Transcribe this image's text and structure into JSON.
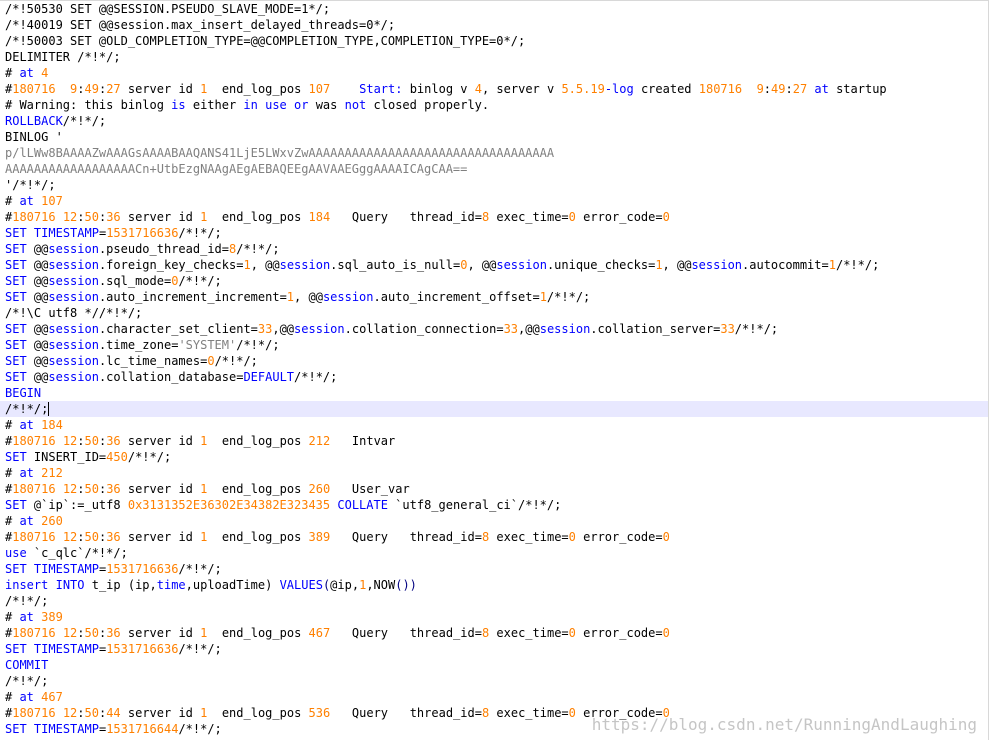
{
  "editor": {
    "current_line": 25,
    "lines": [
      [
        [
          "d",
          "/*!50530 SET @@SESSION.PSEUDO_SLAVE_MODE=1*/;"
        ]
      ],
      [
        [
          "d",
          "/*!40019 SET @@session.max_insert_delayed_threads=0*/;"
        ]
      ],
      [
        [
          "d",
          "/*!50003 SET @OLD_COMPLETION_TYPE=@@COMPLETION_TYPE,COMPLETION_TYPE=0*/;"
        ]
      ],
      [
        [
          "d",
          "DELIMITER /*!*/;"
        ]
      ],
      [
        [
          "d",
          "# "
        ],
        [
          "k",
          "at"
        ],
        [
          "d",
          " "
        ],
        [
          "n",
          "4"
        ]
      ],
      [
        [
          "d",
          "#"
        ],
        [
          "n",
          "180716"
        ],
        [
          "d",
          "  "
        ],
        [
          "n",
          "9"
        ],
        [
          "d",
          ":"
        ],
        [
          "n",
          "49"
        ],
        [
          "d",
          ":"
        ],
        [
          "n",
          "27"
        ],
        [
          "d",
          " server id "
        ],
        [
          "n",
          "1"
        ],
        [
          "d",
          "  end_log_pos "
        ],
        [
          "n",
          "107"
        ],
        [
          "d",
          "    "
        ],
        [
          "k",
          "Start:"
        ],
        [
          "d",
          " binlog v "
        ],
        [
          "n",
          "4"
        ],
        [
          "d",
          ", server v "
        ],
        [
          "n",
          "5.5.19"
        ],
        [
          "k",
          "-log"
        ],
        [
          "d",
          " created "
        ],
        [
          "n",
          "180716"
        ],
        [
          "d",
          "  "
        ],
        [
          "n",
          "9"
        ],
        [
          "d",
          ":"
        ],
        [
          "n",
          "49"
        ],
        [
          "d",
          ":"
        ],
        [
          "n",
          "27"
        ],
        [
          "d",
          " "
        ],
        [
          "k",
          "at"
        ],
        [
          "d",
          " startup"
        ]
      ],
      [
        [
          "d",
          "# Warning: this binlog "
        ],
        [
          "k",
          "is"
        ],
        [
          "d",
          " either "
        ],
        [
          "k",
          "in"
        ],
        [
          "d",
          " "
        ],
        [
          "k",
          "use"
        ],
        [
          "d",
          " "
        ],
        [
          "k",
          "or"
        ],
        [
          "d",
          " was "
        ],
        [
          "k",
          "not"
        ],
        [
          "d",
          " closed properly."
        ]
      ],
      [
        [
          "k",
          "ROLLBACK"
        ],
        [
          "d",
          "/*!*/;"
        ]
      ],
      [
        [
          "d",
          "BINLOG '"
        ]
      ],
      [
        [
          "s",
          "p/lLWw8BAAAAZwAAAGsAAAABAAQANS41LjE5LWxvZwAAAAAAAAAAAAAAAAAAAAAAAAAAAAAAAAAA"
        ]
      ],
      [
        [
          "s",
          "AAAAAAAAAAAAAAAAAACn+UtbEzgNAAgAEgAEBAQEEgAAVAAEGggAAAAICAgCAA=="
        ]
      ],
      [
        [
          "d",
          "'/*!*/;"
        ]
      ],
      [
        [
          "d",
          "# "
        ],
        [
          "k",
          "at"
        ],
        [
          "d",
          " "
        ],
        [
          "n",
          "107"
        ]
      ],
      [
        [
          "d",
          "#"
        ],
        [
          "n",
          "180716"
        ],
        [
          "d",
          " "
        ],
        [
          "n",
          "12"
        ],
        [
          "d",
          ":"
        ],
        [
          "n",
          "50"
        ],
        [
          "d",
          ":"
        ],
        [
          "n",
          "36"
        ],
        [
          "d",
          " server id "
        ],
        [
          "n",
          "1"
        ],
        [
          "d",
          "  end_log_pos "
        ],
        [
          "n",
          "184"
        ],
        [
          "d",
          "   Query   thread_id="
        ],
        [
          "n",
          "8"
        ],
        [
          "d",
          " exec_time="
        ],
        [
          "n",
          "0"
        ],
        [
          "d",
          " error_code="
        ],
        [
          "n",
          "0"
        ]
      ],
      [
        [
          "k",
          "SET"
        ],
        [
          "d",
          " "
        ],
        [
          "k",
          "TIMESTAMP"
        ],
        [
          "d",
          "="
        ],
        [
          "n",
          "1531716636"
        ],
        [
          "d",
          "/*!*/;"
        ]
      ],
      [
        [
          "k",
          "SET"
        ],
        [
          "d",
          " @@"
        ],
        [
          "k",
          "session"
        ],
        [
          "d",
          ".pseudo_thread_id="
        ],
        [
          "n",
          "8"
        ],
        [
          "d",
          "/*!*/;"
        ]
      ],
      [
        [
          "k",
          "SET"
        ],
        [
          "d",
          " @@"
        ],
        [
          "k",
          "session"
        ],
        [
          "d",
          ".foreign_key_checks="
        ],
        [
          "n",
          "1"
        ],
        [
          "d",
          ", @@"
        ],
        [
          "k",
          "session"
        ],
        [
          "d",
          ".sql_auto_is_null="
        ],
        [
          "n",
          "0"
        ],
        [
          "d",
          ", @@"
        ],
        [
          "k",
          "session"
        ],
        [
          "d",
          ".unique_checks="
        ],
        [
          "n",
          "1"
        ],
        [
          "d",
          ", @@"
        ],
        [
          "k",
          "session"
        ],
        [
          "d",
          ".autocommit="
        ],
        [
          "n",
          "1"
        ],
        [
          "d",
          "/*!*/;"
        ]
      ],
      [
        [
          "k",
          "SET"
        ],
        [
          "d",
          " @@"
        ],
        [
          "k",
          "session"
        ],
        [
          "d",
          ".sql_mode="
        ],
        [
          "n",
          "0"
        ],
        [
          "d",
          "/*!*/;"
        ]
      ],
      [
        [
          "k",
          "SET"
        ],
        [
          "d",
          " @@"
        ],
        [
          "k",
          "session"
        ],
        [
          "d",
          ".auto_increment_increment="
        ],
        [
          "n",
          "1"
        ],
        [
          "d",
          ", @@"
        ],
        [
          "k",
          "session"
        ],
        [
          "d",
          ".auto_increment_offset="
        ],
        [
          "n",
          "1"
        ],
        [
          "d",
          "/*!*/;"
        ]
      ],
      [
        [
          "d",
          "/*!\\C utf8 *//*!*/;"
        ]
      ],
      [
        [
          "k",
          "SET"
        ],
        [
          "d",
          " @@"
        ],
        [
          "k",
          "session"
        ],
        [
          "d",
          ".character_set_client="
        ],
        [
          "n",
          "33"
        ],
        [
          "d",
          ",@@"
        ],
        [
          "k",
          "session"
        ],
        [
          "d",
          ".collation_connection="
        ],
        [
          "n",
          "33"
        ],
        [
          "d",
          ",@@"
        ],
        [
          "k",
          "session"
        ],
        [
          "d",
          ".collation_server="
        ],
        [
          "n",
          "33"
        ],
        [
          "d",
          "/*!*/;"
        ]
      ],
      [
        [
          "k",
          "SET"
        ],
        [
          "d",
          " @@"
        ],
        [
          "k",
          "session"
        ],
        [
          "d",
          ".time_zone="
        ],
        [
          "s",
          "'SYSTEM'"
        ],
        [
          "d",
          "/*!*/;"
        ]
      ],
      [
        [
          "k",
          "SET"
        ],
        [
          "d",
          " @@"
        ],
        [
          "k",
          "session"
        ],
        [
          "d",
          ".lc_time_names="
        ],
        [
          "n",
          "0"
        ],
        [
          "d",
          "/*!*/;"
        ]
      ],
      [
        [
          "k",
          "SET"
        ],
        [
          "d",
          " @@"
        ],
        [
          "k",
          "session"
        ],
        [
          "d",
          ".collation_database="
        ],
        [
          "k",
          "DEFAULT"
        ],
        [
          "d",
          "/*!*/;"
        ]
      ],
      [
        [
          "k",
          "BEGIN"
        ]
      ],
      [
        [
          "d",
          "/*!*/;"
        ]
      ],
      [
        [
          "d",
          "# "
        ],
        [
          "k",
          "at"
        ],
        [
          "d",
          " "
        ],
        [
          "n",
          "184"
        ]
      ],
      [
        [
          "d",
          "#"
        ],
        [
          "n",
          "180716"
        ],
        [
          "d",
          " "
        ],
        [
          "n",
          "12"
        ],
        [
          "d",
          ":"
        ],
        [
          "n",
          "50"
        ],
        [
          "d",
          ":"
        ],
        [
          "n",
          "36"
        ],
        [
          "d",
          " server id "
        ],
        [
          "n",
          "1"
        ],
        [
          "d",
          "  end_log_pos "
        ],
        [
          "n",
          "212"
        ],
        [
          "d",
          "   Intvar"
        ]
      ],
      [
        [
          "k",
          "SET"
        ],
        [
          "d",
          " INSERT_ID="
        ],
        [
          "n",
          "450"
        ],
        [
          "d",
          "/*!*/;"
        ]
      ],
      [
        [
          "d",
          "# "
        ],
        [
          "k",
          "at"
        ],
        [
          "d",
          " "
        ],
        [
          "n",
          "212"
        ]
      ],
      [
        [
          "d",
          "#"
        ],
        [
          "n",
          "180716"
        ],
        [
          "d",
          " "
        ],
        [
          "n",
          "12"
        ],
        [
          "d",
          ":"
        ],
        [
          "n",
          "50"
        ],
        [
          "d",
          ":"
        ],
        [
          "n",
          "36"
        ],
        [
          "d",
          " server id "
        ],
        [
          "n",
          "1"
        ],
        [
          "d",
          "  end_log_pos "
        ],
        [
          "n",
          "260"
        ],
        [
          "d",
          "   User_var"
        ]
      ],
      [
        [
          "k",
          "SET"
        ],
        [
          "d",
          " @`ip`:=_utf8 "
        ],
        [
          "n",
          "0x3131352E36302E34382E323435"
        ],
        [
          "d",
          " "
        ],
        [
          "k",
          "COLLATE"
        ],
        [
          "d",
          " `utf8_general_ci`/*!*/;"
        ]
      ],
      [
        [
          "d",
          "# "
        ],
        [
          "k",
          "at"
        ],
        [
          "d",
          " "
        ],
        [
          "n",
          "260"
        ]
      ],
      [
        [
          "d",
          "#"
        ],
        [
          "n",
          "180716"
        ],
        [
          "d",
          " "
        ],
        [
          "n",
          "12"
        ],
        [
          "d",
          ":"
        ],
        [
          "n",
          "50"
        ],
        [
          "d",
          ":"
        ],
        [
          "n",
          "36"
        ],
        [
          "d",
          " server id "
        ],
        [
          "n",
          "1"
        ],
        [
          "d",
          "  end_log_pos "
        ],
        [
          "n",
          "389"
        ],
        [
          "d",
          "   Query   thread_id="
        ],
        [
          "n",
          "8"
        ],
        [
          "d",
          " exec_time="
        ],
        [
          "n",
          "0"
        ],
        [
          "d",
          " error_code="
        ],
        [
          "n",
          "0"
        ]
      ],
      [
        [
          "k",
          "use"
        ],
        [
          "d",
          " `c_qlc`/*!*/;"
        ]
      ],
      [
        [
          "k",
          "SET"
        ],
        [
          "d",
          " "
        ],
        [
          "k",
          "TIMESTAMP"
        ],
        [
          "d",
          "="
        ],
        [
          "n",
          "1531716636"
        ],
        [
          "d",
          "/*!*/;"
        ]
      ],
      [
        [
          "k",
          "insert"
        ],
        [
          "d",
          " "
        ],
        [
          "k",
          "INTO"
        ],
        [
          "d",
          " t_ip (ip,"
        ],
        [
          "k",
          "time"
        ],
        [
          "d",
          ",uploadTime) "
        ],
        [
          "k",
          "VALUES"
        ],
        [
          "p",
          "("
        ],
        [
          "d",
          "@ip,"
        ],
        [
          "n",
          "1"
        ],
        [
          "d",
          ",NOW"
        ],
        [
          "p",
          "())"
        ]
      ],
      [
        [
          "d",
          "/*!*/;"
        ]
      ],
      [
        [
          "d",
          "# "
        ],
        [
          "k",
          "at"
        ],
        [
          "d",
          " "
        ],
        [
          "n",
          "389"
        ]
      ],
      [
        [
          "d",
          "#"
        ],
        [
          "n",
          "180716"
        ],
        [
          "d",
          " "
        ],
        [
          "n",
          "12"
        ],
        [
          "d",
          ":"
        ],
        [
          "n",
          "50"
        ],
        [
          "d",
          ":"
        ],
        [
          "n",
          "36"
        ],
        [
          "d",
          " server id "
        ],
        [
          "n",
          "1"
        ],
        [
          "d",
          "  end_log_pos "
        ],
        [
          "n",
          "467"
        ],
        [
          "d",
          "   Query   thread_id="
        ],
        [
          "n",
          "8"
        ],
        [
          "d",
          " exec_time="
        ],
        [
          "n",
          "0"
        ],
        [
          "d",
          " error_code="
        ],
        [
          "n",
          "0"
        ]
      ],
      [
        [
          "k",
          "SET"
        ],
        [
          "d",
          " "
        ],
        [
          "k",
          "TIMESTAMP"
        ],
        [
          "d",
          "="
        ],
        [
          "n",
          "1531716636"
        ],
        [
          "d",
          "/*!*/;"
        ]
      ],
      [
        [
          "k",
          "COMMIT"
        ]
      ],
      [
        [
          "d",
          "/*!*/;"
        ]
      ],
      [
        [
          "d",
          "# "
        ],
        [
          "k",
          "at"
        ],
        [
          "d",
          " "
        ],
        [
          "n",
          "467"
        ]
      ],
      [
        [
          "d",
          "#"
        ],
        [
          "n",
          "180716"
        ],
        [
          "d",
          " "
        ],
        [
          "n",
          "12"
        ],
        [
          "d",
          ":"
        ],
        [
          "n",
          "50"
        ],
        [
          "d",
          ":"
        ],
        [
          "n",
          "44"
        ],
        [
          "d",
          " server id "
        ],
        [
          "n",
          "1"
        ],
        [
          "d",
          "  end_log_pos "
        ],
        [
          "n",
          "536"
        ],
        [
          "d",
          "   Query   thread_id="
        ],
        [
          "n",
          "8"
        ],
        [
          "d",
          " exec_time="
        ],
        [
          "n",
          "0"
        ],
        [
          "d",
          " error_code="
        ],
        [
          "n",
          "0"
        ]
      ],
      [
        [
          "k",
          "SET"
        ],
        [
          "d",
          " "
        ],
        [
          "k",
          "TIMESTAMP"
        ],
        [
          "d",
          "="
        ],
        [
          "n",
          "1531716644"
        ],
        [
          "d",
          "/*!*/;"
        ]
      ]
    ]
  },
  "watermark": "https://blog.csdn.net/RunningAndLaughing",
  "colors": {
    "keyword": "#0000ff",
    "number": "#ff8000",
    "string": "#808080",
    "text": "#000000",
    "current_line": "#e8e8ff"
  }
}
